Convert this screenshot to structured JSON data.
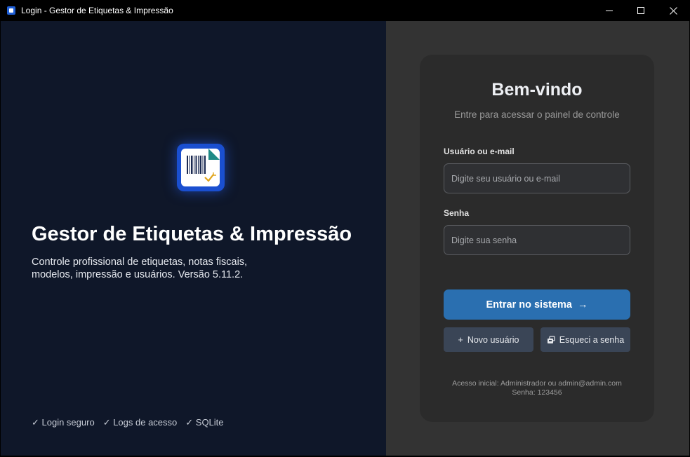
{
  "window": {
    "title": "Login - Gestor de Etiquetas & Impressão",
    "icon": "app-icon"
  },
  "brand": {
    "title": "Gestor de Etiquetas & Impressão",
    "description": "Controle profissional de etiquetas, notas fiscais, modelos, impressão e usuários. Versão 5.11.2.",
    "logo_icon": "barcode-label-icon",
    "accent": "#1a4fd0"
  },
  "features": [
    "✓ Login seguro",
    "✓ Logs de acesso",
    "✓ SQLite"
  ],
  "login": {
    "heading": "Bem-vindo",
    "subtitle": "Entre para acessar o painel de controle",
    "user_label": "Usuário ou e-mail",
    "user_placeholder": "Digite seu usuário ou e-mail",
    "pass_label": "Senha",
    "pass_placeholder": "Digite sua senha",
    "submit_label": "Entrar no sistema",
    "submit_arrow": "→",
    "new_user_label": "Novo usuário",
    "new_user_glyph": "+",
    "forgot_label": "Esqueci a senha",
    "hint_line1": "Acesso inicial: Administrador ou admin@admin.com",
    "hint_line2": "Senha: 123456",
    "primary_color": "#2a6fb0"
  }
}
